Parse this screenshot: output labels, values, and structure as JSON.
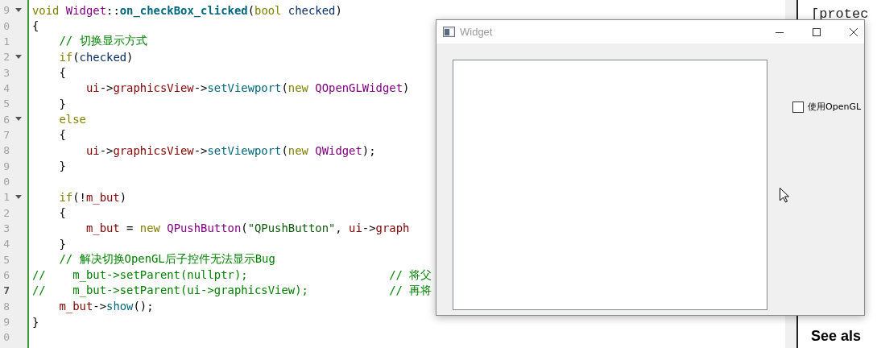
{
  "editor": {
    "lines": [
      {
        "number": "9",
        "foldable": true,
        "current": false,
        "segments": [
          {
            "kind": "keyword",
            "text": "void "
          },
          {
            "kind": "type",
            "text": "Widget"
          },
          {
            "kind": "plain",
            "text": "::"
          },
          {
            "kind": "declaration",
            "text": "on_checkBox_clicked"
          },
          {
            "kind": "plain",
            "text": "("
          },
          {
            "kind": "keyword",
            "text": "bool "
          },
          {
            "kind": "param",
            "text": "checked"
          },
          {
            "kind": "plain",
            "text": ")"
          }
        ]
      },
      {
        "number": "0",
        "foldable": false,
        "current": false,
        "segments": [
          {
            "kind": "plain",
            "text": "{"
          }
        ]
      },
      {
        "number": "1",
        "foldable": false,
        "current": false,
        "segments": [
          {
            "kind": "comment",
            "text": "    // 切换显示方式"
          }
        ]
      },
      {
        "number": "2",
        "foldable": true,
        "current": false,
        "segments": [
          {
            "kind": "keyword",
            "text": "    if"
          },
          {
            "kind": "plain",
            "text": "("
          },
          {
            "kind": "param",
            "text": "checked"
          },
          {
            "kind": "plain",
            "text": ")"
          }
        ]
      },
      {
        "number": "3",
        "foldable": false,
        "current": false,
        "segments": [
          {
            "kind": "plain",
            "text": "    {"
          }
        ]
      },
      {
        "number": "4",
        "foldable": false,
        "current": false,
        "segments": [
          {
            "kind": "member",
            "text": "        ui"
          },
          {
            "kind": "plain",
            "text": "->"
          },
          {
            "kind": "member",
            "text": "graphicsView"
          },
          {
            "kind": "plain",
            "text": "->"
          },
          {
            "kind": "function",
            "text": "setViewport"
          },
          {
            "kind": "plain",
            "text": "("
          },
          {
            "kind": "keyword",
            "text": "new "
          },
          {
            "kind": "type",
            "text": "QOpenGLWidget"
          },
          {
            "kind": "plain",
            "text": ")"
          }
        ]
      },
      {
        "number": "5",
        "foldable": false,
        "current": false,
        "segments": [
          {
            "kind": "plain",
            "text": "    }"
          }
        ]
      },
      {
        "number": "6",
        "foldable": true,
        "current": false,
        "segments": [
          {
            "kind": "keyword",
            "text": "    else"
          }
        ]
      },
      {
        "number": "7",
        "foldable": false,
        "current": false,
        "segments": [
          {
            "kind": "plain",
            "text": "    {"
          }
        ]
      },
      {
        "number": "8",
        "foldable": false,
        "current": false,
        "segments": [
          {
            "kind": "member",
            "text": "        ui"
          },
          {
            "kind": "plain",
            "text": "->"
          },
          {
            "kind": "member",
            "text": "graphicsView"
          },
          {
            "kind": "plain",
            "text": "->"
          },
          {
            "kind": "function",
            "text": "setViewport"
          },
          {
            "kind": "plain",
            "text": "("
          },
          {
            "kind": "keyword",
            "text": "new "
          },
          {
            "kind": "type",
            "text": "QWidget"
          },
          {
            "kind": "plain",
            "text": ");"
          }
        ]
      },
      {
        "number": "9",
        "foldable": false,
        "current": false,
        "segments": [
          {
            "kind": "plain",
            "text": "    }"
          }
        ]
      },
      {
        "number": "0",
        "foldable": false,
        "current": false
      },
      {
        "number": "1",
        "foldable": true,
        "current": false,
        "segments": [
          {
            "kind": "keyword",
            "text": "    if"
          },
          {
            "kind": "plain",
            "text": "(!"
          },
          {
            "kind": "member",
            "text": "m_but"
          },
          {
            "kind": "plain",
            "text": ")"
          }
        ]
      },
      {
        "number": "2",
        "foldable": false,
        "current": false,
        "segments": [
          {
            "kind": "plain",
            "text": "    {"
          }
        ]
      },
      {
        "number": "3",
        "foldable": false,
        "current": false,
        "segments": [
          {
            "kind": "member",
            "text": "        m_but"
          },
          {
            "kind": "plain",
            "text": " = "
          },
          {
            "kind": "keyword",
            "text": "new "
          },
          {
            "kind": "type",
            "text": "QPushButton"
          },
          {
            "kind": "plain",
            "text": "("
          },
          {
            "kind": "string",
            "text": "\"QPushButton\""
          },
          {
            "kind": "plain",
            "text": ", "
          },
          {
            "kind": "member",
            "text": "ui"
          },
          {
            "kind": "plain",
            "text": "->"
          },
          {
            "kind": "member",
            "text": "graph"
          }
        ]
      },
      {
        "number": "4",
        "foldable": false,
        "current": false,
        "segments": [
          {
            "kind": "plain",
            "text": "    }"
          }
        ]
      },
      {
        "number": "5",
        "foldable": false,
        "current": false,
        "segments": [
          {
            "kind": "comment",
            "text": "    // 解决切换OpenGL后子控件无法显示Bug"
          }
        ]
      },
      {
        "number": "6",
        "foldable": false,
        "current": false,
        "segments": [
          {
            "kind": "comment",
            "text": "//    m_but->setParent(nullptr);                     // 将父"
          }
        ]
      },
      {
        "number": "7",
        "foldable": false,
        "current": true,
        "segments": [
          {
            "kind": "comment",
            "text": "//    m_but->setParent(ui->graphicsView);            // 再将"
          }
        ]
      },
      {
        "number": "8",
        "foldable": false,
        "current": false,
        "segments": [
          {
            "kind": "member",
            "text": "    m_but"
          },
          {
            "kind": "plain",
            "text": "->"
          },
          {
            "kind": "function",
            "text": "show"
          },
          {
            "kind": "plain",
            "text": "();"
          }
        ]
      },
      {
        "number": "9",
        "foldable": false,
        "current": false,
        "segments": [
          {
            "kind": "plain",
            "text": "}"
          }
        ]
      },
      {
        "number": "0",
        "foldable": false,
        "current": false
      }
    ]
  },
  "docs": {
    "heading": "[protec",
    "see_also": "See als"
  },
  "window": {
    "title": "Widget",
    "checkbox": {
      "label": "使用OpenGL",
      "checked": false
    }
  }
}
